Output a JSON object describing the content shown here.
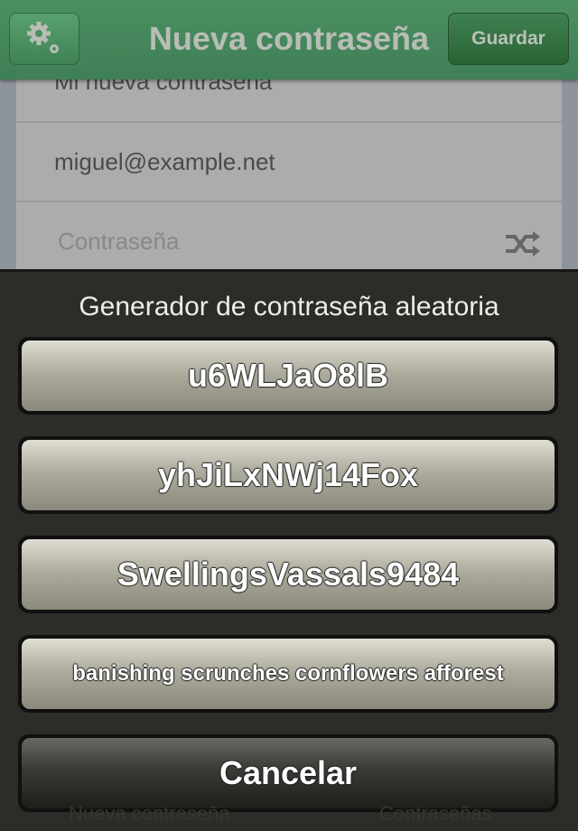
{
  "header": {
    "title": "Nueva contraseña",
    "save_label": "Guardar"
  },
  "form": {
    "name_value": "Mi nueva contraseña",
    "email_value": "miguel@example.net",
    "password_placeholder": "Contraseña"
  },
  "sheet": {
    "title": "Generador de contraseña aleatoria",
    "options": [
      "u6WLJaO8lB",
      "yhJiLxNWj14Fox",
      "SwellingsVassals9484",
      "banishing scrunches cornflowers afforest"
    ],
    "cancel_label": "Cancelar"
  },
  "tabs": [
    "Nueva contraseña",
    "Contraseñas"
  ]
}
